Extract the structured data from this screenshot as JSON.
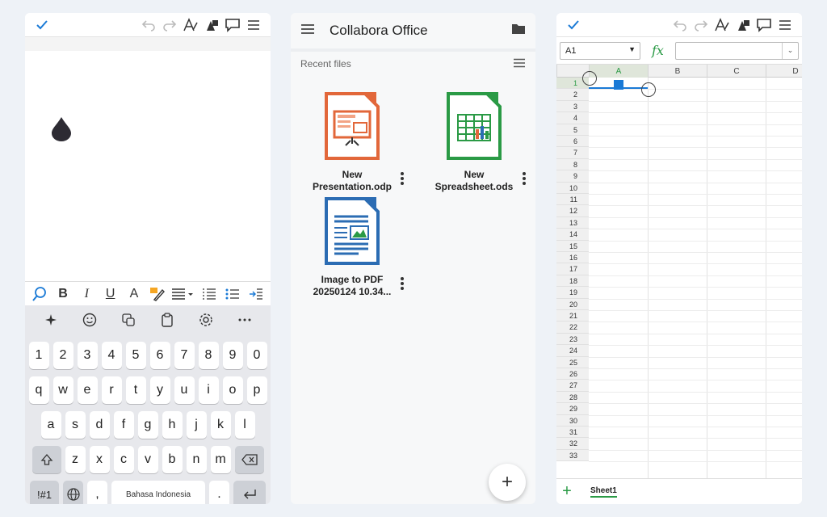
{
  "writer": {
    "toolbar": {
      "confirm_icon": "check-icon",
      "undo_icon": "undo-icon",
      "redo_icon": "redo-icon"
    },
    "format_bar": {
      "bold": "B",
      "italic": "I",
      "underline": "U",
      "font_color": "A"
    },
    "keyboard": {
      "numbers": [
        "1",
        "2",
        "3",
        "4",
        "5",
        "6",
        "7",
        "8",
        "9",
        "0"
      ],
      "row1": [
        "q",
        "w",
        "e",
        "r",
        "t",
        "y",
        "u",
        "i",
        "o",
        "p"
      ],
      "row2": [
        "a",
        "s",
        "d",
        "f",
        "g",
        "h",
        "j",
        "k",
        "l"
      ],
      "row3": [
        "z",
        "x",
        "c",
        "v",
        "b",
        "n",
        "m"
      ],
      "symbols_key": "!#1",
      "comma": ",",
      "space_label": "Bahasa Indonesia",
      "period": "."
    }
  },
  "browser": {
    "app_title": "Collabora Office",
    "section_label": "Recent files",
    "files": [
      {
        "name_line1": "New",
        "name_line2": "Presentation.odp",
        "type": "presentation",
        "color": "#e2673a"
      },
      {
        "name_line1": "New",
        "name_line2": "Spreadsheet.ods",
        "type": "spreadsheet",
        "color": "#2a9a45"
      },
      {
        "name_line1": "Image to PDF",
        "name_line2": "20250124 10.34...",
        "type": "document",
        "color": "#2b6cb3"
      }
    ],
    "fab_label": "+"
  },
  "calc": {
    "name_box": "A1",
    "fx_label": "fx",
    "columns": [
      "A",
      "B",
      "C",
      "D"
    ],
    "rows": [
      "1",
      "2",
      "3",
      "4",
      "5",
      "6",
      "7",
      "8",
      "9",
      "10",
      "11",
      "12",
      "13",
      "14",
      "15",
      "16",
      "17",
      "18",
      "19",
      "20",
      "21",
      "22",
      "23",
      "24",
      "25",
      "26",
      "27",
      "28",
      "29",
      "30",
      "31",
      "32",
      "33"
    ],
    "sheet_tab": "Sheet1",
    "add_sheet": "+"
  },
  "colors": {
    "accent_green": "#2a9a45",
    "accent_blue": "#1a7ad6",
    "impress": "#e2673a",
    "writer": "#2b6cb3"
  }
}
